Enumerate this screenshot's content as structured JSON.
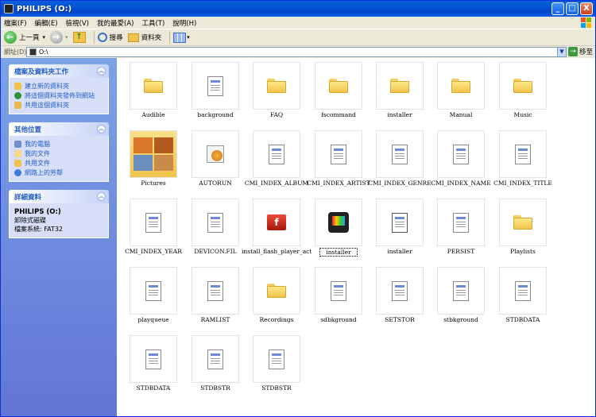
{
  "window": {
    "title": "PHILIPS (O:)",
    "buttons": [
      "_",
      "□",
      "X"
    ]
  },
  "menu": [
    "檔案(F)",
    "編輯(E)",
    "檢視(V)",
    "我的最愛(A)",
    "工具(T)",
    "說明(H)"
  ],
  "toolbar": {
    "back": "上一頁",
    "search": "搜尋",
    "folders": "資料夾"
  },
  "address": {
    "label": "網址(D)",
    "value": "O:\\",
    "go": "移至"
  },
  "tasks_panel": {
    "title": "檔案及資料夾工作",
    "items": [
      "建立新的資料夾",
      "將這個資料夾發佈到網站",
      "共用這個資料夾"
    ]
  },
  "places_panel": {
    "title": "其他位置",
    "items": [
      "我的電腦",
      "我的文件",
      "共用文件",
      "網路上的芳鄰"
    ]
  },
  "details_panel": {
    "title": "詳細資料",
    "name": "PHILIPS (O:)",
    "type": "卸除式磁碟",
    "fs": "檔案系統: FAT32"
  },
  "files": [
    {
      "name": "Audible",
      "kind": "folder"
    },
    {
      "name": "background",
      "kind": "doc"
    },
    {
      "name": "FAQ",
      "kind": "folder"
    },
    {
      "name": "fscommand",
      "kind": "folder"
    },
    {
      "name": "installer",
      "kind": "folder"
    },
    {
      "name": "Manual",
      "kind": "folder"
    },
    {
      "name": "Music",
      "kind": "folder"
    },
    {
      "name": "Pictures",
      "kind": "pictures"
    },
    {
      "name": "AUTORUN",
      "kind": "autorun"
    },
    {
      "name": "CMI_INDEX_ALBUM",
      "kind": "doc"
    },
    {
      "name": "CMI_INDEX_ARTIST",
      "kind": "doc"
    },
    {
      "name": "CMI_INDEX_GENRE",
      "kind": "doc"
    },
    {
      "name": "CMI_INDEX_NAME",
      "kind": "doc"
    },
    {
      "name": "CMI_INDEX_TITLE",
      "kind": "doc"
    },
    {
      "name": "CMI_INDEX_YEAR",
      "kind": "doc"
    },
    {
      "name": "DEVICON.FIL",
      "kind": "doc"
    },
    {
      "name": "install_flash_player_act...",
      "kind": "flash"
    },
    {
      "name": "installer",
      "kind": "device",
      "selected": true
    },
    {
      "name": "installer",
      "kind": "doc2"
    },
    {
      "name": "PERSIST",
      "kind": "doc"
    },
    {
      "name": "Playlists",
      "kind": "folder"
    },
    {
      "name": "playqueue",
      "kind": "doc"
    },
    {
      "name": "RAMLIST",
      "kind": "doc"
    },
    {
      "name": "Recordings",
      "kind": "folder"
    },
    {
      "name": "sdbkground",
      "kind": "doc"
    },
    {
      "name": "SETSTOR",
      "kind": "doc"
    },
    {
      "name": "stbkground",
      "kind": "doc"
    },
    {
      "name": "STDBDATA",
      "kind": "doc"
    },
    {
      "name": "STDBDATA",
      "kind": "doc"
    },
    {
      "name": "STDBSTR",
      "kind": "doc"
    },
    {
      "name": "STDBSTR",
      "kind": "doc"
    }
  ]
}
